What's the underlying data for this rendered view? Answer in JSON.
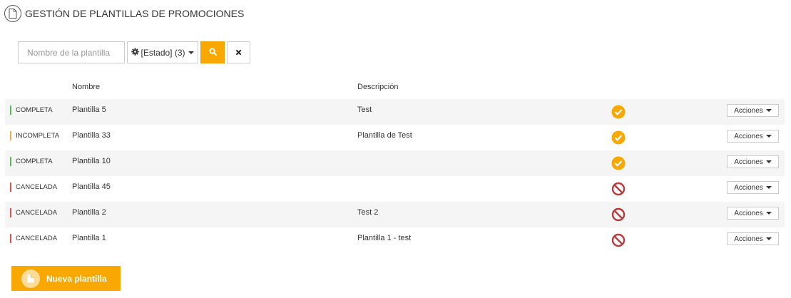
{
  "header": {
    "title": "GESTIÓN DE PLANTILLAS DE PROMOCIONES",
    "icon": "document-icon"
  },
  "filters": {
    "search_placeholder": "Nombre de la plantilla",
    "estado_label": "[Estado] (3)",
    "search_icon": "search-icon",
    "clear_icon": "close-icon"
  },
  "columns": {
    "nombre": "Nombre",
    "descripcion": "Descripción"
  },
  "rows": [
    {
      "status": "COMPLETA",
      "status_type": "complete",
      "name": "Plantilla 5",
      "description": "Test",
      "state_icon": "check-circle-icon",
      "actions_label": "Acciones"
    },
    {
      "status": "INCOMPLETA",
      "status_type": "incomplete",
      "name": "Plantilla 33",
      "description": "Plantilla de Test",
      "state_icon": "check-circle-icon",
      "actions_label": "Acciones"
    },
    {
      "status": "COMPLETA",
      "status_type": "complete",
      "name": "Plantilla 10",
      "description": "",
      "state_icon": "check-circle-icon",
      "actions_label": "Acciones"
    },
    {
      "status": "CANCELADA",
      "status_type": "cancelled",
      "name": "Plantilla 45",
      "description": "",
      "state_icon": "ban-icon",
      "actions_label": "Acciones"
    },
    {
      "status": "CANCELADA",
      "status_type": "cancelled",
      "name": "Plantilla 2",
      "description": "Test 2",
      "state_icon": "ban-icon",
      "actions_label": "Acciones"
    },
    {
      "status": "CANCELADA",
      "status_type": "cancelled",
      "name": "Plantilla 1",
      "description": "Plantilla 1 - test",
      "state_icon": "ban-icon",
      "actions_label": "Acciones"
    }
  ],
  "new_button": {
    "label": "Nueva plantilla",
    "icon": "document-icon"
  },
  "colors": {
    "accent": "#f9a801",
    "complete": "#5cb85c",
    "incomplete": "#f0ad4e",
    "cancelled": "#d9534f",
    "ban": "#b83a3a",
    "check": "#f9a801"
  }
}
